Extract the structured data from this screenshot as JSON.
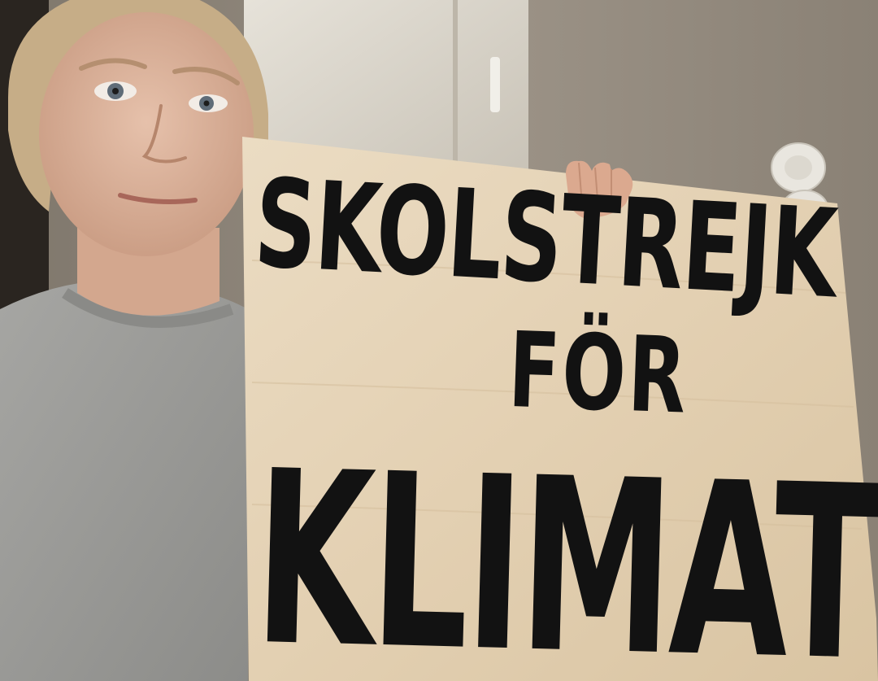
{
  "scene": {
    "colors": {
      "wall": "#8f877c",
      "door": "#d8d3c9",
      "sweater": "#9a9a97",
      "skin": "#d9b19a",
      "hair": "#c9b18c",
      "board": "#e4d2b6",
      "paint": "#121212"
    }
  },
  "sign": {
    "line_1": "SKOLSTREJK",
    "line_2": "FÖR",
    "line_3": "KLIMATET"
  }
}
